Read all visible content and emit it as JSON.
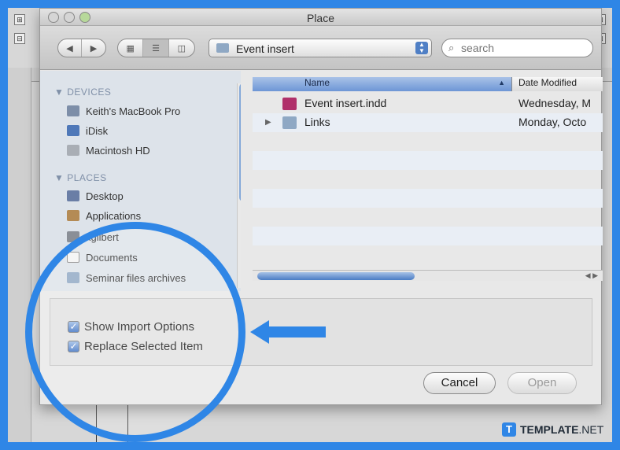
{
  "window": {
    "title": "Place"
  },
  "toolbar": {
    "path_label": "Event insert",
    "search_placeholder": "search",
    "search_icon": "magnifier-icon"
  },
  "sidebar": {
    "devices_label": "DEVICES",
    "devices": [
      {
        "label": "Keith's MacBook Pro",
        "icon": "laptop-icon"
      },
      {
        "label": "iDisk",
        "icon": "idisk-icon"
      },
      {
        "label": "Macintosh HD",
        "icon": "hard-drive-icon"
      }
    ],
    "places_label": "PLACES",
    "places": [
      {
        "label": "Desktop",
        "icon": "desktop-icon"
      },
      {
        "label": "Applications",
        "icon": "applications-icon"
      },
      {
        "label": "kgilbert",
        "icon": "home-icon"
      },
      {
        "label": "Documents",
        "icon": "documents-icon"
      },
      {
        "label": "Seminar files archives",
        "icon": "folder-icon"
      }
    ]
  },
  "filelist": {
    "columns": {
      "name": "Name",
      "date": "Date Modified"
    },
    "rows": [
      {
        "name": "Event insert.indd",
        "date": "Wednesday, M",
        "icon": "indesign-file-icon"
      },
      {
        "name": "Links",
        "date": "Monday, Octo",
        "icon": "folder-icon"
      }
    ]
  },
  "options": {
    "show_import_options": {
      "label": "Show Import Options",
      "checked": true
    },
    "replace_selected_item": {
      "label": "Replace Selected Item",
      "checked": true
    }
  },
  "buttons": {
    "cancel": "Cancel",
    "open": "Open"
  },
  "watermark": {
    "mark": "T",
    "brand": "TEMPLATE",
    "suffix": ".NET"
  },
  "colors": {
    "accent": "#2f86e6",
    "selection": "#6d96d6"
  }
}
